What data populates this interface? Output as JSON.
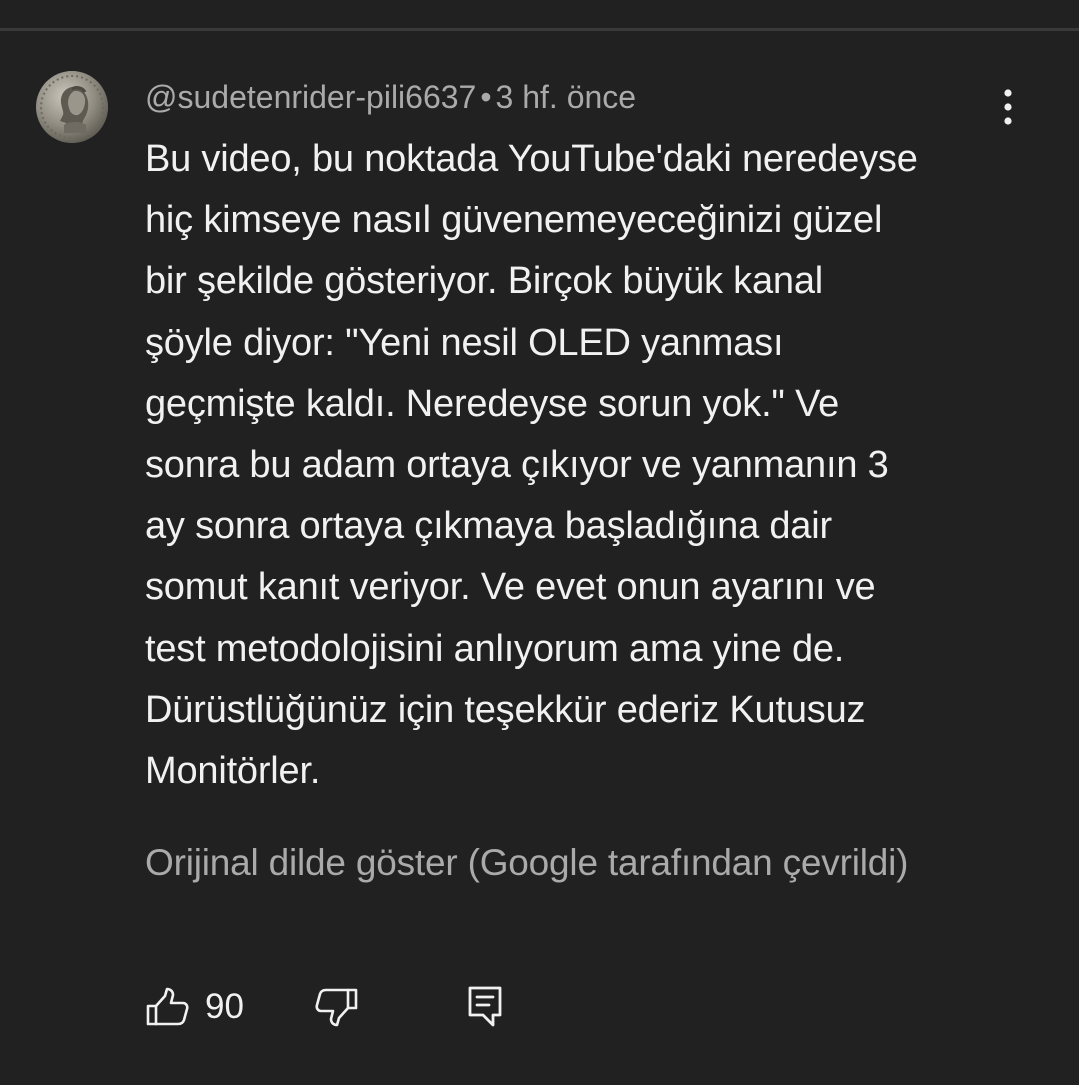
{
  "comment": {
    "author": "@sudetenrider-pili6637",
    "separator": "•",
    "time": "3 hf. önce",
    "text_lines": [
      "Bu video, bu noktada YouTube'daki neredeyse",
      "hiç kimseye nasıl güvenemeyeceğinizi güzel",
      "bir şekilde gösteriyor. Birçok büyük kanal",
      "şöyle diyor: \"Yeni nesil OLED yanması",
      "geçmişte kaldı. Neredeyse sorun yok.\" Ve",
      "sonra bu adam ortaya çıkıyor ve yanmanın 3",
      "ay sonra ortaya çıkmaya başladığına dair",
      "somut kanıt veriyor. Ve evet onun ayarını ve",
      "test metodolojisini anlıyorum ama yine de.",
      "Dürüstlüğünüz için teşekkür ederiz Kutusuz",
      "Monitörler."
    ],
    "translate_link": "Orijinal dilde göster (Google tarafından çevrildi)"
  },
  "actions": {
    "like_count": "90"
  },
  "icons": {
    "avatar": "coin-portrait-avatar",
    "menu": "more-vert-icon",
    "like": "thumb-up-icon",
    "dislike": "thumb-down-icon",
    "reply": "reply-comment-icon"
  },
  "colors": {
    "background": "#212121",
    "text_primary": "#f1f1f1",
    "text_secondary": "#aaaaaa"
  }
}
